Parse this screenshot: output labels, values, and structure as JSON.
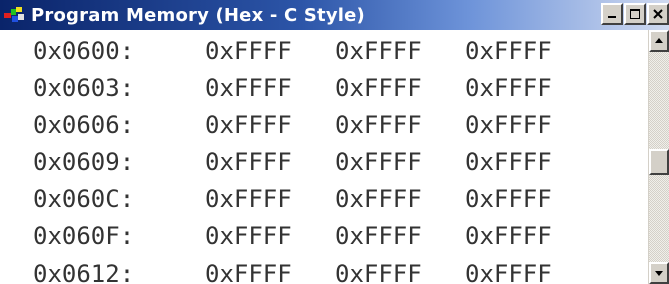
{
  "window": {
    "title": "Program Memory (Hex - C Style)"
  },
  "controls": {
    "minimize_icon": "minimize-icon",
    "maximize_icon": "maximize-icon",
    "close_icon": "close-icon"
  },
  "memory": {
    "rows": [
      {
        "address": "0x0600:",
        "values": [
          "0xFFFF",
          "0xFFFF",
          "0xFFFF"
        ]
      },
      {
        "address": "0x0603:",
        "values": [
          "0xFFFF",
          "0xFFFF",
          "0xFFFF"
        ]
      },
      {
        "address": "0x0606:",
        "values": [
          "0xFFFF",
          "0xFFFF",
          "0xFFFF"
        ]
      },
      {
        "address": "0x0609:",
        "values": [
          "0xFFFF",
          "0xFFFF",
          "0xFFFF"
        ]
      },
      {
        "address": "0x060C:",
        "values": [
          "0xFFFF",
          "0xFFFF",
          "0xFFFF"
        ]
      },
      {
        "address": "0x060F:",
        "values": [
          "0xFFFF",
          "0xFFFF",
          "0xFFFF"
        ]
      },
      {
        "address": "0x0612:",
        "values": [
          "0xFFFF",
          "0xFFFF",
          "0xFFFF"
        ]
      }
    ]
  },
  "colors": {
    "title_bar_start": "#0a246a",
    "title_bar_end": "#d0daf0",
    "text": "#333333"
  }
}
